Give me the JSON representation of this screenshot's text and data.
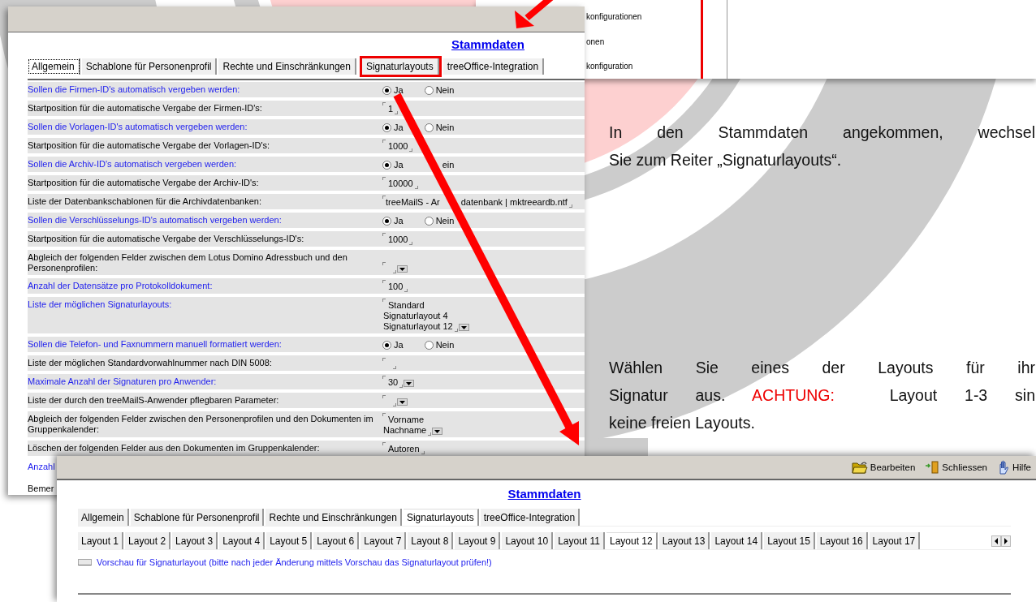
{
  "background_window": {
    "items": [
      "konfigurationen",
      "onen",
      "konfiguration"
    ]
  },
  "main_window": {
    "heading": "Stammdaten",
    "tabs": [
      {
        "label": "Allgemein",
        "selected": true,
        "highlighted": false
      },
      {
        "label": "Schablone für Personenprofil",
        "selected": false,
        "highlighted": false
      },
      {
        "label": "Rechte und Einschränkungen",
        "selected": false,
        "highlighted": false
      },
      {
        "label": "Signaturlayouts",
        "selected": false,
        "highlighted": true
      },
      {
        "label": "treeOffice-Integration",
        "selected": false,
        "highlighted": false
      }
    ],
    "rows": [
      {
        "label": "Sollen die Firmen-ID's automatisch vergeben werden:",
        "accent": true,
        "kind": "radio",
        "options": [
          {
            "label": "Ja",
            "selected": true
          },
          {
            "label": "Nein",
            "selected": false
          }
        ]
      },
      {
        "label": "Startposition für die automatische Vergabe der Firmen-ID's:",
        "accent": false,
        "kind": "field",
        "lines": [
          "1"
        ]
      },
      {
        "label": "Sollen die Vorlagen-ID's automatisch vergeben werden:",
        "accent": true,
        "kind": "radio",
        "options": [
          {
            "label": "Ja",
            "selected": true
          },
          {
            "label": "Nein",
            "selected": false
          }
        ]
      },
      {
        "label": "Startposition für die automatische Vergabe der Vorlagen-ID's:",
        "accent": false,
        "kind": "field",
        "lines": [
          "1000"
        ]
      },
      {
        "label": "Sollen die Archiv-ID's automatisch vergeben werden:",
        "accent": true,
        "kind": "radio",
        "options": [
          {
            "label": "Ja",
            "selected": true
          },
          {
            "label": "ein"
          }
        ]
      },
      {
        "label": "Startposition für die automatische Vergabe der Archiv-ID's:",
        "accent": false,
        "kind": "field",
        "lines": [
          "10000"
        ]
      },
      {
        "label": "Liste der Datenbankschablonen für die Archivdatenbanken:",
        "accent": false,
        "kind": "split_field",
        "parts": [
          "treeMailS - Ar",
          "datenbank | mktreeardb.ntf"
        ]
      },
      {
        "label": "Sollen die Verschlüsselungs-ID's automatisch vergeben werden:",
        "accent": true,
        "kind": "radio",
        "options": [
          {
            "label": "Ja",
            "selected": true
          },
          {
            "label": "Nein",
            "selected": false
          }
        ]
      },
      {
        "label": "Startposition für die automatische Vergabe der Verschlüsselungs-ID's:",
        "accent": false,
        "kind": "field",
        "lines": [
          "1000"
        ]
      },
      {
        "label": "Abgleich der folgenden Felder zwischen dem Lotus Domino Adressbuch und den Personenprofilen:",
        "accent": false,
        "kind": "field",
        "lines": [],
        "dropdown": true
      },
      {
        "label": "Anzahl der Datensätze pro Protokolldokument:",
        "accent": true,
        "kind": "field",
        "lines": [
          "100"
        ]
      },
      {
        "label": "Liste der möglichen Signaturlayouts:",
        "accent": true,
        "kind": "field",
        "lines": [
          "Standard",
          "Signaturlayout 4",
          "Signaturlayout 12"
        ],
        "dropdown": true
      },
      {
        "label": "Sollen die Telefon- und Faxnummern manuell formatiert werden:",
        "accent": true,
        "kind": "radio",
        "options": [
          {
            "label": "Ja",
            "selected": true
          },
          {
            "label": "Nein",
            "selected": false
          }
        ]
      },
      {
        "label": "Liste der möglichen Standardvorwahlnummer nach DIN 5008:",
        "accent": false,
        "kind": "field",
        "lines": []
      },
      {
        "label": "Maximale Anzahl der Signaturen pro Anwender:",
        "accent": true,
        "kind": "field",
        "lines": [
          "30"
        ],
        "dropdown": true
      },
      {
        "label": "Liste der durch den treeMailS-Anwender pflegbaren Parameter:",
        "accent": false,
        "kind": "field",
        "lines": [],
        "dropdown": true
      },
      {
        "label": "Abgleich der folgenden Felder zwischen den Personenprofilen und den Dokumenten im Gruppenkalender:",
        "accent": false,
        "kind": "field",
        "lines": [
          "Vorname",
          "Nachname"
        ],
        "dropdown": true
      },
      {
        "label": "Löschen der folgenden Felder aus den Dokumenten im Gruppenkalender:",
        "accent": false,
        "kind": "field",
        "lines": [
          "Autoren"
        ]
      },
      {
        "label": "Anzahl",
        "accent": true,
        "kind": "text"
      },
      {
        "label": "Bemer",
        "accent": false,
        "kind": "text"
      }
    ]
  },
  "instructions": [
    {
      "lines": [
        [
          {
            "text": "In den Stammdaten angekommen, wechsel"
          }
        ],
        [
          {
            "text": "Sie zum Reiter „Signaturlayouts“."
          }
        ]
      ]
    },
    {
      "lines": [
        [
          {
            "text": "Wählen Sie eines der Layouts für ihr"
          }
        ],
        [
          {
            "text": "Signatur aus. "
          },
          {
            "text": "ACHTUNG:",
            "warning": true
          },
          {
            "text": "  Layout 1-3 sin"
          }
        ],
        [
          {
            "text": "keine freien Layouts."
          }
        ]
      ]
    }
  ],
  "detail_window": {
    "toolbar": [
      {
        "label": "Bearbeiten"
      },
      {
        "label": "Schliessen"
      },
      {
        "label": "Hilfe"
      }
    ],
    "heading": "Stammdaten",
    "tabs": [
      {
        "label": "Allgemein",
        "selected": false
      },
      {
        "label": "Schablone für Personenprofil",
        "selected": false
      },
      {
        "label": "Rechte und Einschränkungen",
        "selected": false
      },
      {
        "label": "Signaturlayouts",
        "selected": true
      },
      {
        "label": "treeOffice-Integration",
        "selected": false
      }
    ],
    "layout_tabs": [
      {
        "label": "Layout 1",
        "selected": false
      },
      {
        "label": "Layout 2",
        "selected": false
      },
      {
        "label": "Layout 3",
        "selected": false
      },
      {
        "label": "Layout 4",
        "selected": false
      },
      {
        "label": "Layout 5",
        "selected": false
      },
      {
        "label": "Layout 6",
        "selected": false
      },
      {
        "label": "Layout 7",
        "selected": false
      },
      {
        "label": "Layout 8",
        "selected": false
      },
      {
        "label": "Layout 9",
        "selected": false
      },
      {
        "label": "Layout 10",
        "selected": false
      },
      {
        "label": "Layout 11",
        "selected": false
      },
      {
        "label": "Layout 12",
        "selected": true
      },
      {
        "label": "Layout 13",
        "selected": false
      },
      {
        "label": "Layout 14",
        "selected": false
      },
      {
        "label": "Layout 15",
        "selected": false
      },
      {
        "label": "Layout 16",
        "selected": false
      },
      {
        "label": "Layout 17",
        "selected": false
      }
    ],
    "preview": {
      "label": "Vorschau für Signaturlayout (bitte nach jeder Änderung mittels Vorschau das Signaturlayout prüfen!)",
      "checked": false
    }
  }
}
